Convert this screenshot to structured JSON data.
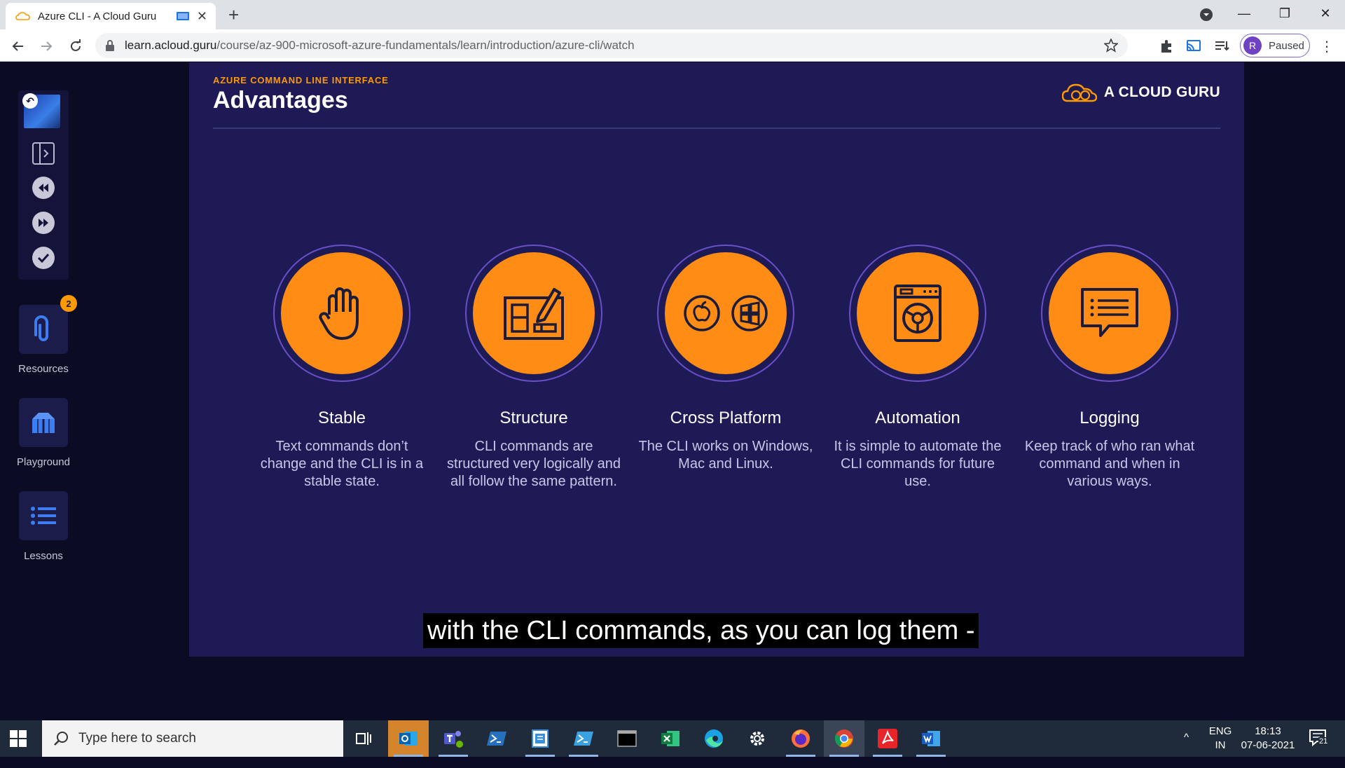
{
  "browser": {
    "tab_title": "Azure CLI - A Cloud Guru",
    "url_host": "learn.acloud.guru",
    "url_path": "/course/az-900-microsoft-azure-fundamentals/learn/introduction/azure-cli/watch",
    "profile_initial": "R",
    "profile_status": "Paused"
  },
  "sidebar": {
    "resources_label": "Resources",
    "resources_badge": "2",
    "playground_label": "Playground",
    "lessons_label": "Lessons"
  },
  "slide": {
    "eyebrow": "AZURE COMMAND LINE INTERFACE",
    "heading": "Advantages",
    "brand": "A CLOUD GURU",
    "features": [
      {
        "title": "Stable",
        "desc": "Text commands don’t change and the CLI is in a stable state.",
        "icon": "hand-icon"
      },
      {
        "title": "Structure",
        "desc": "CLI commands are structured very logically and all follow the same pattern.",
        "icon": "blueprint-pencil-icon"
      },
      {
        "title": "Cross Platform",
        "desc": "The CLI works on Windows, Mac and Linux.",
        "icon": "apple-windows-icon"
      },
      {
        "title": "Automation",
        "desc": "It is simple to automate the CLI commands for future use.",
        "icon": "washing-machine-icon"
      },
      {
        "title": "Logging",
        "desc": "Keep track of who ran what command and when in various ways.",
        "icon": "chat-log-icon"
      }
    ]
  },
  "caption": "with the CLI commands, as you can log them -",
  "taskbar": {
    "search_placeholder": "Type here to search",
    "lang_top": "ENG",
    "lang_bottom": "IN",
    "time": "18:13",
    "date": "07-06-2021",
    "notif_count": "21"
  },
  "colors": {
    "slide_bg": "#1d1a55",
    "accent": "#ff8c14",
    "ring": "#6a4fc9"
  }
}
